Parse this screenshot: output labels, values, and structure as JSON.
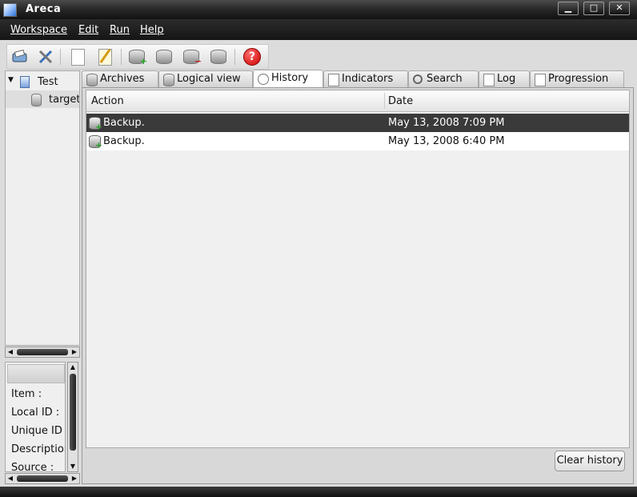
{
  "window": {
    "title": "Areca",
    "controls": [
      "▁",
      "□",
      "✕"
    ]
  },
  "menu": [
    "Workspace",
    "Edit",
    "Run",
    "Help"
  ],
  "toolbar": {
    "help_glyph": "?"
  },
  "tree": {
    "root": "Test",
    "child": "target"
  },
  "props": {
    "items": [
      "Item :",
      "Local ID :",
      "Unique ID :",
      "Description",
      "Source :"
    ]
  },
  "tabs": [
    {
      "label": "Archives",
      "icon": "database-icon"
    },
    {
      "label": "Logical view",
      "icon": "database-icon"
    },
    {
      "label": "History",
      "icon": "clock-icon",
      "active": true
    },
    {
      "label": "Indicators",
      "icon": "document-icon"
    },
    {
      "label": "Search",
      "icon": "magnifier-icon"
    },
    {
      "label": "Log",
      "icon": "document-icon"
    },
    {
      "label": "Progression",
      "icon": "document-icon"
    }
  ],
  "history": {
    "columns": [
      "Action",
      "Date"
    ],
    "rows": [
      {
        "action": "Backup.",
        "date": "May 13, 2008 7:09 PM",
        "selected": true
      },
      {
        "action": "Backup.",
        "date": "May 13, 2008 6:40 PM",
        "selected": false
      }
    ],
    "clear_label": "Clear history"
  }
}
